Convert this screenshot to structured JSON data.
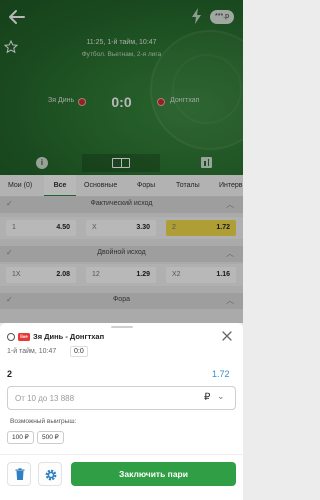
{
  "header": {
    "balance": "***.p",
    "match_time": "11:25, 1-й тайм, 10:47",
    "league": "Футбол. Вьетнам, 2-я лига",
    "team_home": "Зя Динь",
    "team_away": "Донгтхап",
    "score": "0:0",
    "info_glyph": "i"
  },
  "tabs": [
    {
      "label": "Мои (0)",
      "active": false
    },
    {
      "label": "Все",
      "active": true
    },
    {
      "label": "Основные",
      "active": false
    },
    {
      "label": "Форы",
      "active": false
    },
    {
      "label": "Тоталы",
      "active": false
    },
    {
      "label": "Интерв",
      "active": false
    }
  ],
  "markets": [
    {
      "title": "Фактический исход",
      "odds": [
        {
          "label": "1",
          "value": "4.50",
          "selected": false
        },
        {
          "label": "X",
          "value": "3.30",
          "selected": false
        },
        {
          "label": "2",
          "value": "1.72",
          "selected": true
        }
      ]
    },
    {
      "title": "Двойной исход",
      "odds": [
        {
          "label": "1X",
          "value": "2.08",
          "selected": false
        },
        {
          "label": "12",
          "value": "1.29",
          "selected": false
        },
        {
          "label": "X2",
          "value": "1.16",
          "selected": false
        }
      ]
    },
    {
      "title": "Фора",
      "odds": []
    }
  ],
  "betslip": {
    "live_badge": "live",
    "match": "Зя Динь - Донгтхап",
    "period": "1-й тайм, 10:47",
    "score": "0:0",
    "outcome": "2",
    "odd": "1.72",
    "amount_placeholder": "От 10 до 13 888",
    "currency_symbol": "₽",
    "possible_win_label": "Возможный выигрыш:",
    "quick_amounts": [
      "100 ₽",
      "500 ₽"
    ],
    "place_bet_label": "Заключить пари"
  },
  "colors": {
    "accent_green": "#2f9e44",
    "selected_odd": "#f2dc4a",
    "odd_value_blue": "#2f8fd0",
    "live_red": "#e53935"
  }
}
